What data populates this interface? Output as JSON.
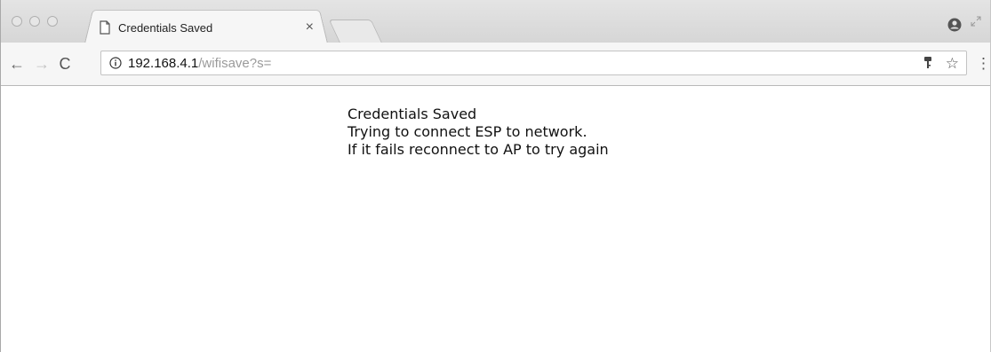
{
  "tab": {
    "title": "Credentials Saved",
    "close_glyph": "×"
  },
  "toolbar": {
    "back_glyph": "←",
    "forward_glyph": "→",
    "reload_glyph": "C",
    "url_host": "192.168.4.1",
    "url_path": "/wifisave?s=",
    "star_glyph": "☆",
    "menu_glyph": "⋮"
  },
  "page": {
    "lines": [
      "Credentials Saved",
      "Trying to connect ESP to network.",
      "If it fails reconnect to AP to try again"
    ]
  }
}
